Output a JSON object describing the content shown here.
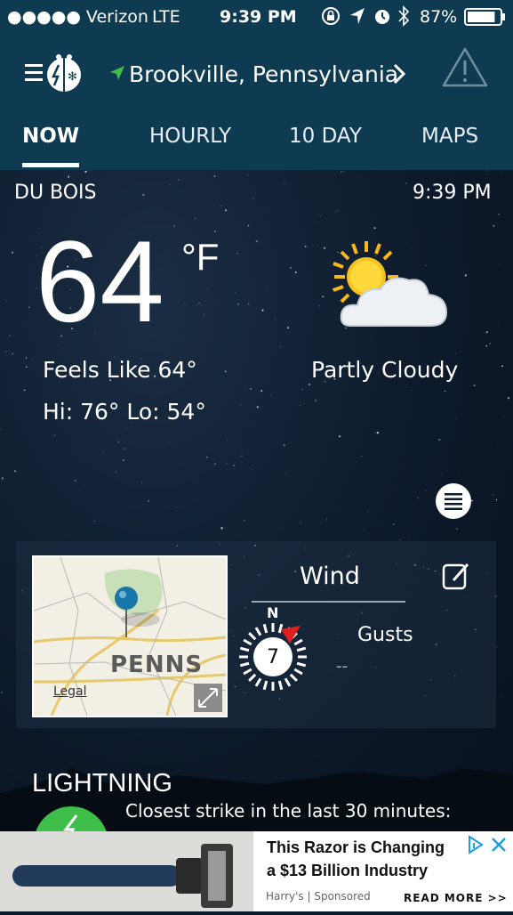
{
  "status_bar": {
    "carrier": "●●●●● Verizon",
    "network": "LTE",
    "time": "9:39 PM",
    "battery": "87%",
    "battery_level": 0.87
  },
  "header": {
    "location": "Brookville, Pennsylvania",
    "tabs": [
      "NOW",
      "HOURLY",
      "10 DAY",
      "MAPS"
    ],
    "active_tab": "NOW"
  },
  "station": {
    "name": "DU BOIS",
    "time": "9:39 PM"
  },
  "current": {
    "temperature": "64",
    "unit": "°F",
    "feels_like": "Feels Like 64°",
    "hi_lo": "Hi: 76° Lo: 54°",
    "condition": "Partly Cloudy",
    "condition_icon": "partly-cloudy-icon"
  },
  "map": {
    "region_label": "PENNS",
    "legal": "Legal"
  },
  "wind": {
    "title": "Wind",
    "direction": "N",
    "speed": "7",
    "gusts_label": "Gusts",
    "gusts_value": "--"
  },
  "lightning": {
    "title": "LIGHTNING",
    "text": "Closest strike in the last 30 minutes:"
  },
  "ad": {
    "headline_line1": "This Razor is Changing",
    "headline_line2": "a $13 Billion Industry",
    "sponsor": "Harry's | Sponsored",
    "cta": "READ MORE >>"
  },
  "colors": {
    "header_bg": "#0f3b52",
    "accent_green": "#3fbf4a",
    "wind_arrow": "#e02020"
  }
}
